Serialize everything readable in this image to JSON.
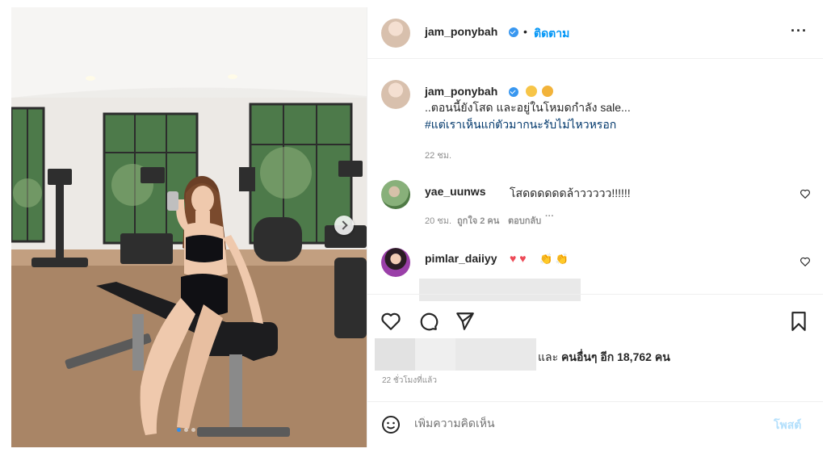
{
  "post": {
    "author": "jam_ponybah",
    "separator": "•",
    "follow_label": "ติดตาม",
    "more_label": "···",
    "image_alt": "Woman seated on a weight bench in a home gym taking a mirror selfie"
  },
  "caption": {
    "author": "jam_ponybah",
    "line1": "..ตอนนี้ยังโสด และอยู่ในโหมดกำลัง sale...",
    "hashtag": "#แต่เราเห็นแก่ตัวมากนะรับไม่ไหวหรอก",
    "time": "22 ชม."
  },
  "comments": [
    {
      "author": "yae_uunws",
      "text": "โสดดดดดดล้าววววว!!!!!!",
      "time": "20 ชม.",
      "likes": "ถูกใจ 2 คน",
      "reply": "ตอบกลับ",
      "more": "···"
    },
    {
      "author": "pimlar_daiiyy",
      "hearts": "♥ ♥",
      "claps": "👏 👏"
    }
  ],
  "likes": {
    "prefix": "และ",
    "bold": "คนอื่นๆ อีก 18,762 คน",
    "ago": "22 ชั่วโมงที่แล้ว"
  },
  "composer": {
    "placeholder": "เพิ่มความคิดเห็น",
    "post_label": "โพสต์"
  },
  "colors": {
    "accent": "#0095f6",
    "verified": "#3897f0",
    "like_red": "#ed4956"
  },
  "icons": [
    "heart-icon",
    "comment-icon",
    "share-icon",
    "bookmark-icon",
    "emoji-icon",
    "more-icon",
    "verified-icon"
  ]
}
